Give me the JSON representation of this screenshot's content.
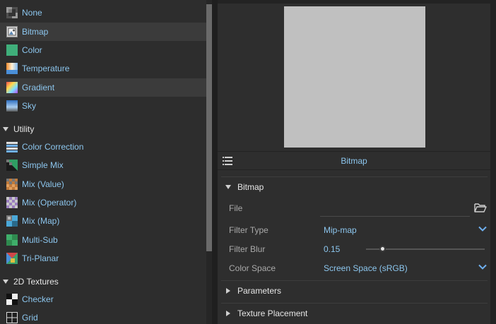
{
  "texture_list": {
    "items_top": [
      {
        "label": "None",
        "icon": "none-texture-icon",
        "highlight": false
      },
      {
        "label": "Bitmap",
        "icon": "bitmap-texture-icon",
        "highlight": true
      },
      {
        "label": "Color",
        "icon": "color-texture-icon",
        "highlight": false
      },
      {
        "label": "Temperature",
        "icon": "temperature-texture-icon",
        "highlight": false
      },
      {
        "label": "Gradient",
        "icon": "gradient-texture-icon",
        "highlight": true
      },
      {
        "label": "Sky",
        "icon": "sky-texture-icon",
        "highlight": false
      }
    ],
    "utility_header": "Utility",
    "utility_items": [
      {
        "label": "Color Correction",
        "icon": "color-correction-icon"
      },
      {
        "label": "Simple Mix",
        "icon": "simple-mix-icon"
      },
      {
        "label": "Mix (Value)",
        "icon": "mix-value-icon"
      },
      {
        "label": "Mix (Operator)",
        "icon": "mix-operator-icon"
      },
      {
        "label": "Mix (Map)",
        "icon": "mix-map-icon"
      },
      {
        "label": "Multi-Sub",
        "icon": "multi-sub-icon"
      },
      {
        "label": "Tri-Planar",
        "icon": "tri-planar-icon"
      }
    ],
    "textures2d_header": "2D Textures",
    "textures2d_items": [
      {
        "label": "Checker",
        "icon": "checker-icon"
      },
      {
        "label": "Grid",
        "icon": "grid-icon"
      }
    ]
  },
  "editor": {
    "preview_color": "#c0c0c0",
    "title": "Bitmap",
    "bitmap_section": "Bitmap",
    "file_label": "File",
    "file_value": "",
    "filter_type_label": "Filter Type",
    "filter_type_value": "Mip-map",
    "filter_blur_label": "Filter Blur",
    "filter_blur_value": "0.15",
    "filter_blur_fraction": 0.15,
    "color_space_label": "Color Space",
    "color_space_value": "Screen Space (sRGB)",
    "parameters_section": "Parameters",
    "texture_placement_section": "Texture Placement"
  },
  "colors": {
    "accent_text": "#8cc6ee",
    "panel_bg": "#2d2d2d",
    "highlight_bg": "#3b3b3b"
  }
}
